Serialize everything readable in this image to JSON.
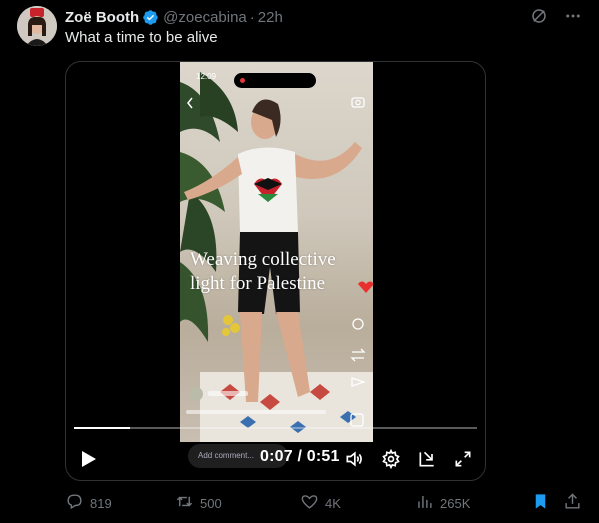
{
  "author": {
    "name": "Zoë Booth",
    "handle": "@zoecabina",
    "separator": "·",
    "time": "22h"
  },
  "tweet": {
    "text": "What a time to be alive"
  },
  "video": {
    "status_time": "12:09",
    "overlay_line1": "Weaving collective",
    "overlay_line2": "light for Palestine",
    "comment_placeholder": "Add comment...",
    "current_time": "0:07",
    "duration": "0:51",
    "progress_fraction": 0.14
  },
  "actions": {
    "replies": "819",
    "reposts": "500",
    "likes": "4K",
    "views": "265K"
  },
  "colors": {
    "verified": "#1d9bf0",
    "bookmark": "#1d9bf0",
    "muted": "#71767b"
  },
  "icons": [
    "verified-badge-icon",
    "grok-icon",
    "more-icon",
    "play-icon",
    "volume-icon",
    "settings-icon",
    "dock-icon",
    "fullscreen-icon",
    "reply-icon",
    "repost-icon",
    "like-icon",
    "views-icon",
    "bookmark-icon",
    "share-icon"
  ]
}
